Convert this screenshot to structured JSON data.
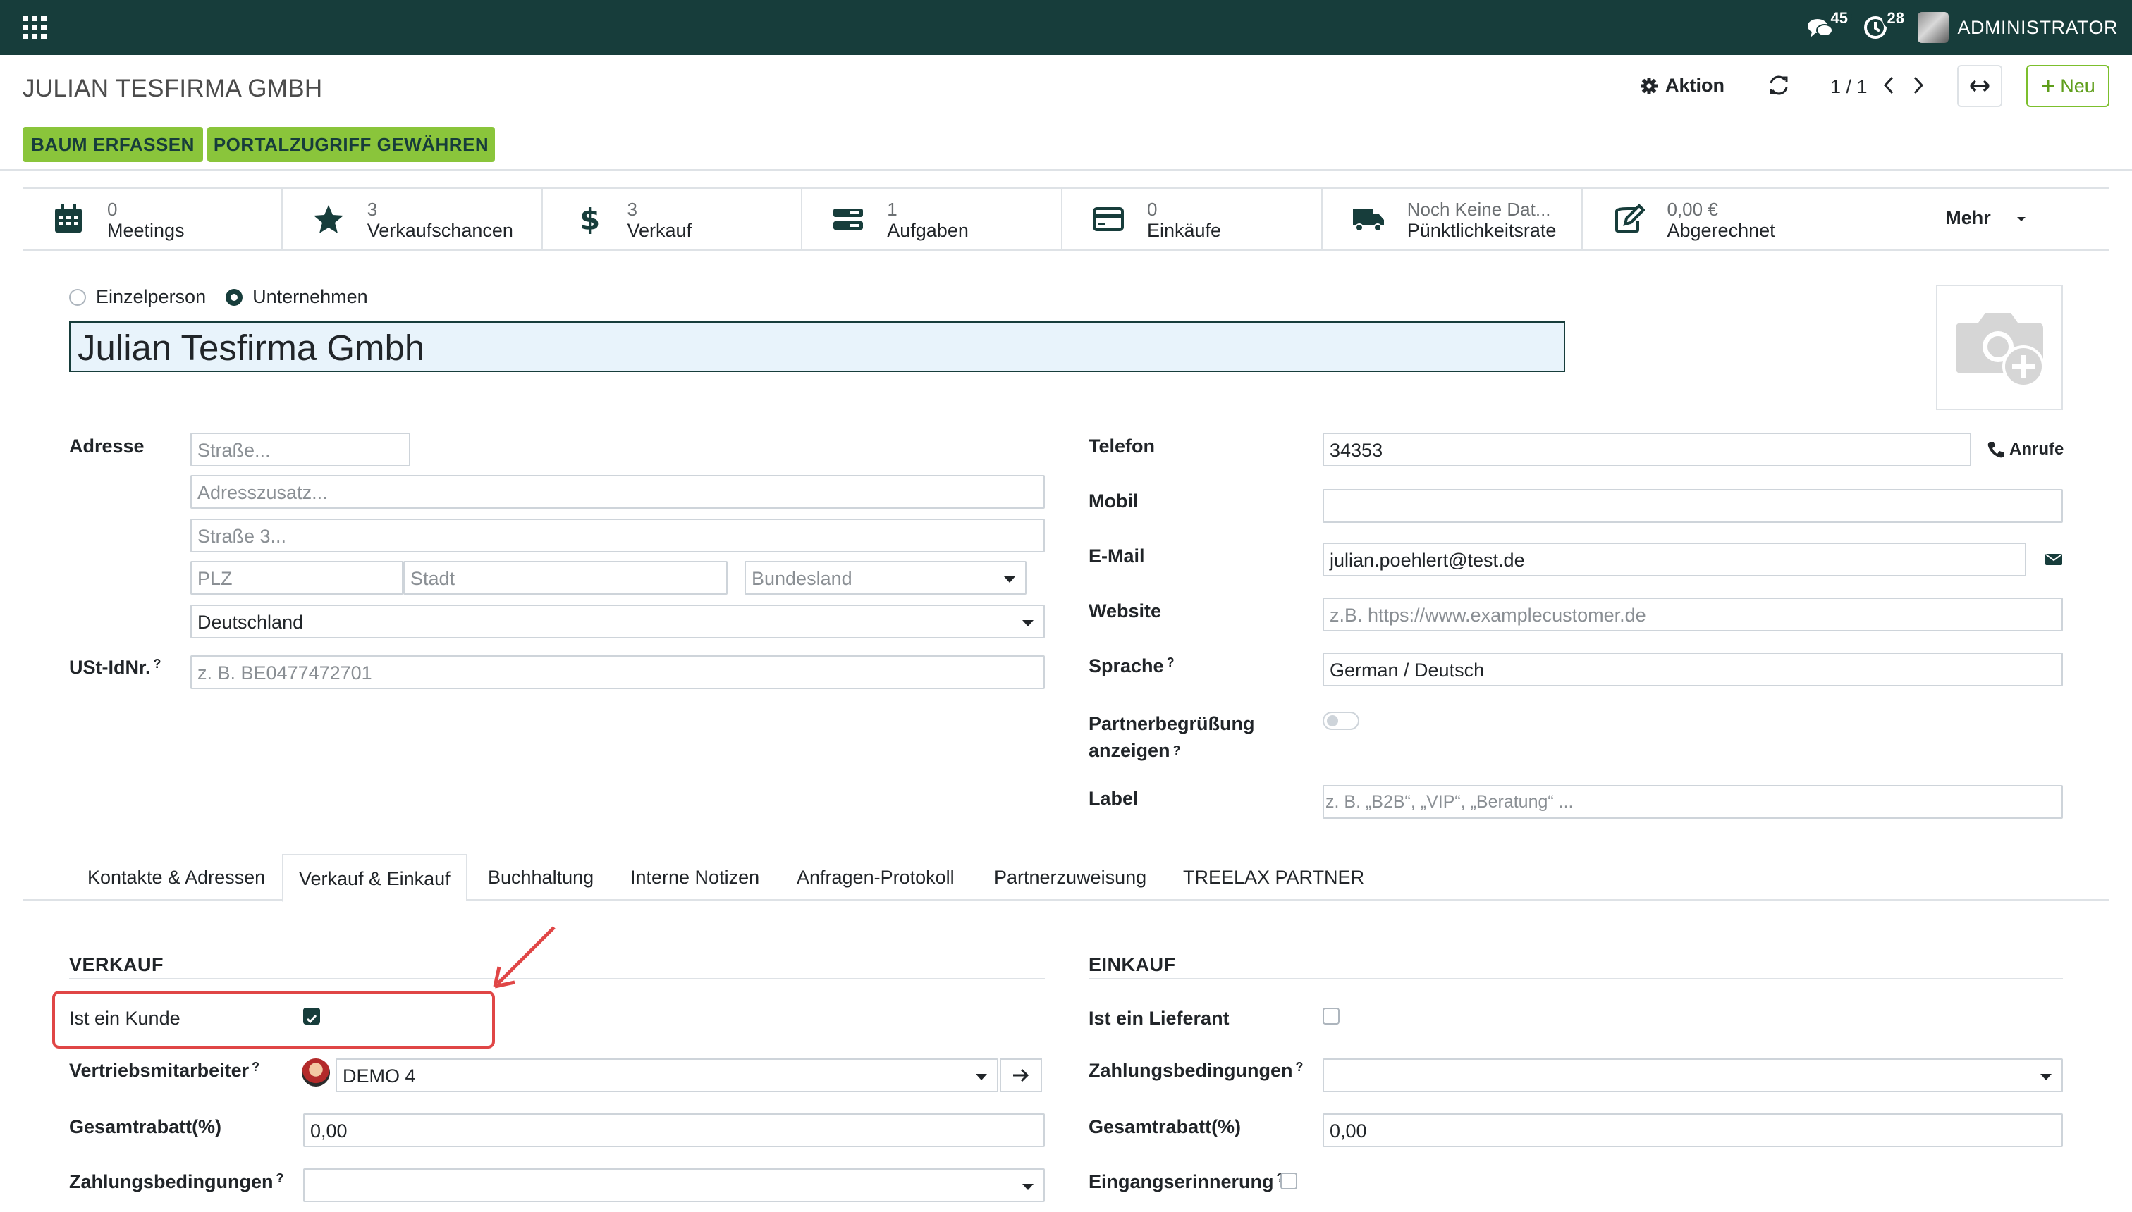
{
  "navbar": {
    "messages_count": "45",
    "activities_count": "28",
    "user_name": "ADMINISTRATOR"
  },
  "control": {
    "title": "JULIAN TESFIRMA GMBH",
    "action_label": "Aktion",
    "pager_value": "1 / 1",
    "new_label": "Neu"
  },
  "buttons": {
    "tree": "BAUM ERFASSEN",
    "portal": "PORTALZUGRIFF GEWÄHREN"
  },
  "stats": [
    {
      "value": "0",
      "label": "Meetings"
    },
    {
      "value": "3",
      "label": "Verkaufschancen"
    },
    {
      "value": "3",
      "label": "Verkauf"
    },
    {
      "value": "1",
      "label": "Aufgaben"
    },
    {
      "value": "0",
      "label": "Einkäufe"
    },
    {
      "value": "Noch Keine Dat...",
      "label": "Pünktlichkeitsrate"
    },
    {
      "value": "0,00 €",
      "label": "Abgerechnet"
    }
  ],
  "stats_more": "Mehr",
  "company_type": {
    "individual": "Einzelperson",
    "company": "Unternehmen",
    "selected": "Unternehmen"
  },
  "name": "Julian Tesfirma Gmbh",
  "address": {
    "label": "Adresse",
    "street_ph": "Straße...",
    "street2_ph": "Adresszusatz...",
    "street3_ph": "Straße 3...",
    "zip_ph": "PLZ",
    "city_ph": "Stadt",
    "state_ph": "Bundesland",
    "country": "Deutschland"
  },
  "vat": {
    "label": "USt-IdNr.",
    "help": "?",
    "placeholder": "z. B. BE0477472701"
  },
  "contact": {
    "phone_label": "Telefon",
    "phone": "34353",
    "call_label": "Anrufe",
    "mobile_label": "Mobil",
    "mobile": "",
    "email_label": "E-Mail",
    "email": "julian.poehlert@test.de",
    "website_label": "Website",
    "website_ph": "z.B. https://www.examplecustomer.de",
    "lang_label": "Sprache",
    "lang_help": "?",
    "lang": "German / Deutsch",
    "greeting_label_1": "Partnerbegrüßung",
    "greeting_label_2": "anzeigen",
    "greeting_help": "?",
    "tag_label": "Label",
    "tag_ph": "z. B. „B2B“, „VIP“, „Beratung“ ..."
  },
  "tabs": [
    "Kontakte & Adressen",
    "Verkauf & Einkauf",
    "Buchhaltung",
    "Interne Notizen",
    "Anfragen-Protokoll",
    "Partnerzuweisung",
    "TREELAX PARTNER"
  ],
  "active_tab": "Verkauf & Einkauf",
  "sales": {
    "title": "VERKAUF",
    "is_customer_label": "Ist ein Kunde",
    "is_customer": true,
    "salesperson_label": "Vertriebsmitarbeiter",
    "salesperson_help": "?",
    "salesperson": "DEMO 4",
    "discount_label": "Gesamtrabatt(%)",
    "discount": "0,00",
    "terms_label": "Zahlungsbedingungen",
    "terms_help": "?",
    "terms": ""
  },
  "purchase": {
    "title": "EINKAUF",
    "is_vendor_label": "Ist ein Lieferant",
    "is_vendor": false,
    "terms_label": "Zahlungsbedingungen",
    "terms_help": "?",
    "terms": "",
    "discount_label": "Gesamtrabatt(%)",
    "discount": "0,00",
    "reminder_label": "Eingangserinnerung",
    "reminder_help": "?",
    "reminder": false
  },
  "colors": {
    "navbar": "#173d3b",
    "accent_green": "#8ac53b",
    "annotation_red": "#e04646"
  }
}
